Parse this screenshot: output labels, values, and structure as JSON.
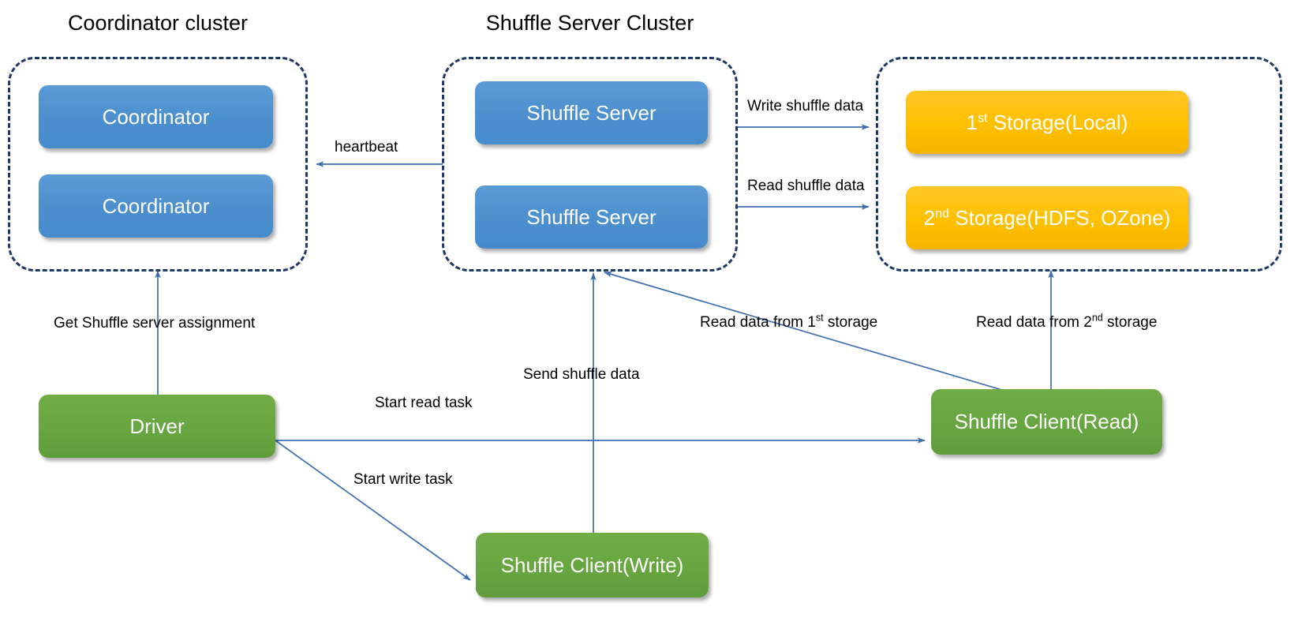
{
  "diagram": {
    "title": "Uniffle / Remote Shuffle Service architecture",
    "colors": {
      "blue": "#5B9BD5",
      "green": "#70AD47",
      "orange": "#FFC000",
      "dashed_border": "#1F3864",
      "arrow": "#4472A8",
      "text_dark": "#000000",
      "text_light": "#FFFFFF",
      "background": "#FFFFFF"
    },
    "clusters": [
      {
        "id": "coordinator-cluster",
        "title": "Coordinator cluster"
      },
      {
        "id": "shuffle-server-cluster",
        "title": "Shuffle Server Cluster"
      },
      {
        "id": "storage-cluster",
        "title": ""
      }
    ],
    "nodes": {
      "coordinator_1": "Coordinator",
      "coordinator_2": "Coordinator",
      "shuffle_server_1": "Shuffle Server",
      "shuffle_server_2": "Shuffle Server",
      "storage_1_prefix": "1",
      "storage_1_sup": "st",
      "storage_1_rest": " Storage(Local)",
      "storage_2_prefix": "2",
      "storage_2_sup": "nd",
      "storage_2_rest": " Storage(HDFS, OZone)",
      "driver": "Driver",
      "shuffle_client_read": "Shuffle Client(Read)",
      "shuffle_client_write": "Shuffle Client(Write)"
    },
    "edges": [
      {
        "id": "heartbeat",
        "label": "heartbeat",
        "from": "shuffle-server-cluster",
        "to": "coordinator-cluster"
      },
      {
        "id": "write-shuffle-data",
        "label": "Write shuffle data",
        "from": "shuffle-server-1",
        "to": "storage-cluster"
      },
      {
        "id": "read-shuffle-data",
        "label": "Read shuffle data",
        "from": "shuffle-server-2",
        "to": "storage-cluster"
      },
      {
        "id": "get-assignment",
        "label": "Get Shuffle server assignment",
        "from": "driver",
        "to": "coordinator-cluster"
      },
      {
        "id": "start-read-task",
        "label": "Start read task",
        "from": "driver",
        "to": "shuffle-client-read"
      },
      {
        "id": "start-write-task",
        "label": "Start write task",
        "from": "driver",
        "to": "shuffle-client-write"
      },
      {
        "id": "send-shuffle-data",
        "label": "Send shuffle data",
        "from": "shuffle-client-write",
        "to": "shuffle-server-cluster"
      },
      {
        "id": "read-data-1st-storage",
        "label_prefix": "Read data from 1",
        "label_sup": "st",
        "label_rest": " storage",
        "from": "shuffle-client-read",
        "to": "shuffle-server-cluster"
      },
      {
        "id": "read-data-2nd-storage",
        "label_prefix": "Read data from 2",
        "label_sup": "nd",
        "label_rest": " storage",
        "from": "shuffle-client-read",
        "to": "storage-cluster"
      }
    ],
    "labels": {
      "heartbeat": "heartbeat",
      "write_shuffle_data": "Write shuffle data",
      "read_shuffle_data": "Read shuffle data",
      "get_assignment": "Get Shuffle server assignment",
      "start_read_task": "Start read task",
      "start_write_task": "Start write task",
      "send_shuffle_data": "Send shuffle data",
      "read_1st_prefix": "Read data from 1",
      "read_1st_sup": "st",
      "read_1st_rest": " storage",
      "read_2nd_prefix": "Read data from 2",
      "read_2nd_sup": "nd",
      "read_2nd_rest": " storage"
    }
  }
}
